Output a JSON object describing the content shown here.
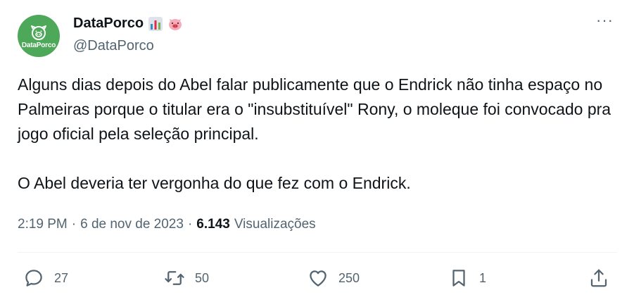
{
  "author": {
    "avatar_text": "DataPorco",
    "display_name": "DataPorco",
    "badges": [
      "bar-chart-emoji",
      "pig-face-emoji"
    ],
    "handle": "@DataPorco"
  },
  "tweet": {
    "paragraphs": [
      "Alguns dias depois do Abel falar publicamente que o Endrick não tinha espaço no Palmeiras porque o titular era o \"insubstituível\" Rony, o moleque foi convocado pra jogo oficial pela seleção principal.",
      "O Abel deveria ter vergonha do que fez com o Endrick."
    ]
  },
  "meta": {
    "time": "2:19 PM",
    "separator": "·",
    "date": "6 de nov de 2023",
    "views_count": "6.143",
    "views_label": "Visualizações"
  },
  "actions": {
    "replies": "27",
    "retweets": "50",
    "likes": "250",
    "bookmarks": "1"
  },
  "more_label": "···",
  "colors": {
    "text": "#0f1419",
    "secondary": "#536471",
    "avatar_bg": "#4ea85a",
    "divider": "#eff3f4"
  }
}
